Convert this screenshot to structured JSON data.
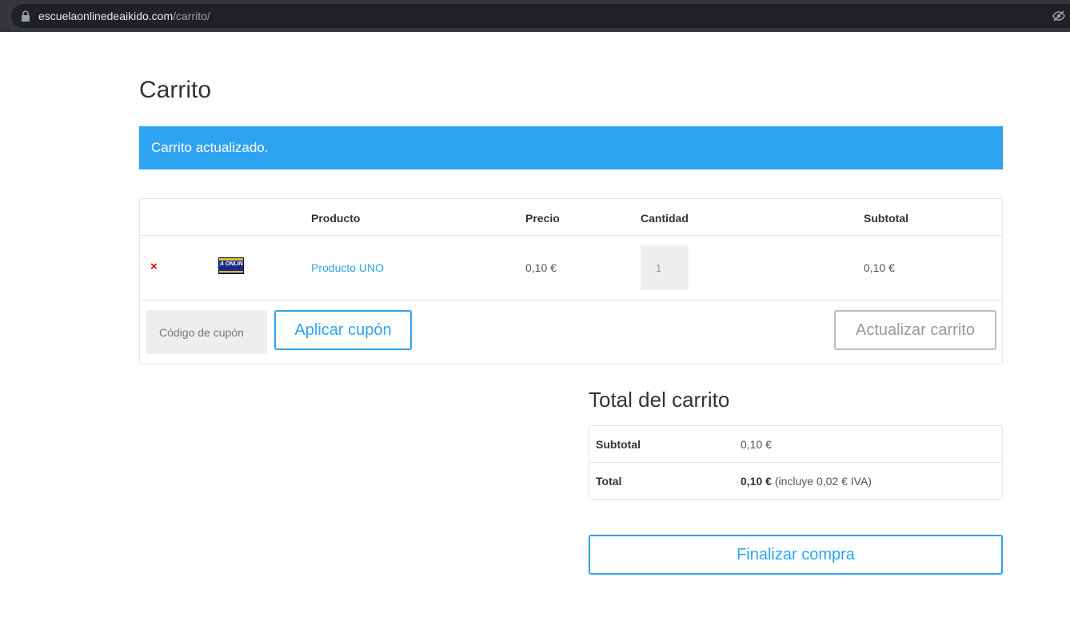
{
  "browser": {
    "url_domain": "escuelaonlinedeaikido.com",
    "url_path": "/carrito/"
  },
  "page": {
    "title": "Carrito",
    "notice": "Carrito actualizado."
  },
  "cart": {
    "headers": {
      "product": "Producto",
      "price": "Precio",
      "quantity": "Cantidad",
      "subtotal": "Subtotal"
    },
    "items": [
      {
        "remove": "×",
        "thumb_text": "A ONLINE DE",
        "name": "Producto UNO",
        "price": "0,10 €",
        "quantity": "1",
        "subtotal": "0,10 €"
      }
    ],
    "coupon_placeholder": "Código de cupón",
    "apply_coupon_label": "Aplicar cupón",
    "update_cart_label": "Actualizar carrito"
  },
  "totals": {
    "title": "Total del carrito",
    "subtotal_label": "Subtotal",
    "subtotal_value": "0,10 €",
    "total_label": "Total",
    "total_value": "0,10 €",
    "total_tax_note": "(incluye 0,02 € IVA)"
  },
  "checkout_label": "Finalizar compra",
  "colors": {
    "accent": "#2ea3f2",
    "remove": "#e30000"
  }
}
